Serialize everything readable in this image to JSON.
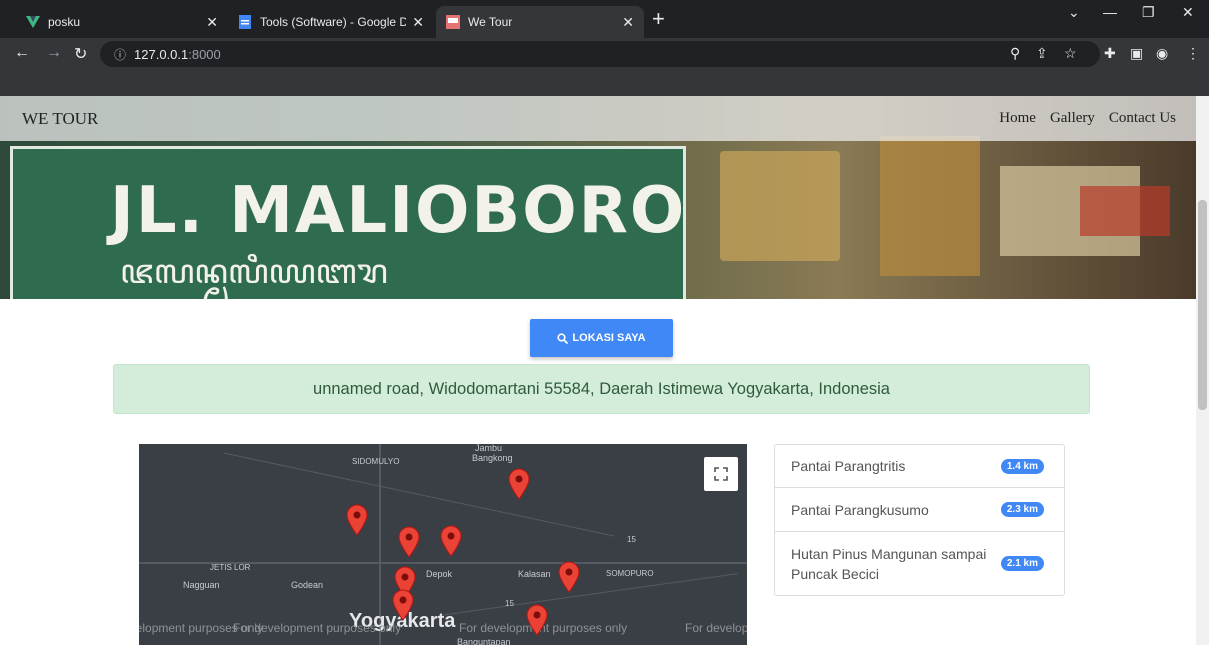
{
  "browser": {
    "tabs": [
      {
        "title": "posku",
        "active": false
      },
      {
        "title": "Tools (Software) - Google Dokum",
        "active": false
      },
      {
        "title": "We Tour",
        "active": true
      }
    ],
    "url_host": "127.0.0.1",
    "url_port": ":8000"
  },
  "site": {
    "brand": "WE TOUR",
    "nav": [
      "Home",
      "Gallery",
      "Contact Us"
    ]
  },
  "hero": {
    "sign_title": "JL. MALIOBORO"
  },
  "lokasi_button": "LOKASI SAYA",
  "address": "unnamed road, Widodomartani 55584, Daerah Istimewa Yogyakarta, Indonesia",
  "map": {
    "labels": {
      "jambu": "Jambu",
      "bangkong": "Bangkong",
      "sidomulyo": "SIDOMULYO",
      "jetis_lor": "JETIS LOR",
      "nagguan": "Nagguan",
      "godean": "Godean",
      "depok": "Depok",
      "kalasan": "Kalasan",
      "somopuro": "SOMOPURO",
      "yogyakarta": "Yogyakarta",
      "banguntapan": "Banguntapan",
      "road15": "15"
    },
    "dev_notice": "For development purposes only"
  },
  "places": [
    {
      "name": "Pantai Parangtritis",
      "distance": "1.4 km"
    },
    {
      "name": "Pantai Parangkusumo",
      "distance": "2.3 km"
    },
    {
      "name": "Hutan Pinus Mangunan sampai Puncak Becici",
      "distance": "2.1 km"
    }
  ],
  "colors": {
    "accent": "#3f88f5",
    "alert_bg": "#d4edda",
    "alert_text": "#2e5b3a"
  }
}
